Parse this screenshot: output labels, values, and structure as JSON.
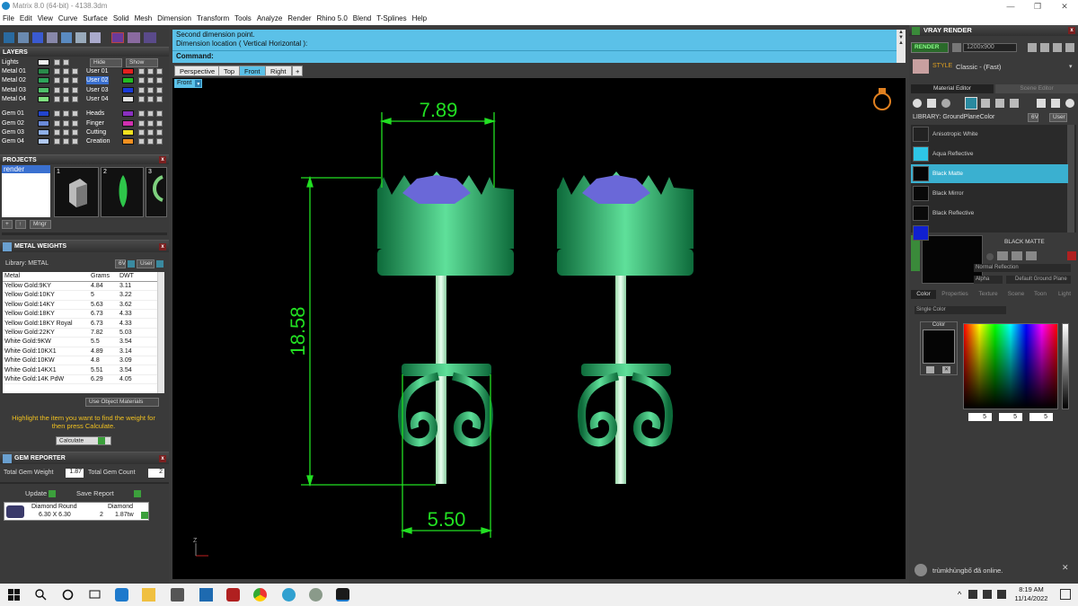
{
  "window": {
    "title": "Matrix 8.0 (64-bit) - 4138.3dm"
  },
  "menu": [
    "File",
    "Edit",
    "View",
    "Curve",
    "Surface",
    "Solid",
    "Mesh",
    "Dimension",
    "Transform",
    "Tools",
    "Analyze",
    "Render",
    "Rhino 5.0",
    "Blend",
    "T-Splines",
    "Help"
  ],
  "layers": {
    "title": "LAYERS",
    "lights": "Lights",
    "hide": "Hide",
    "show": "Show",
    "left": [
      {
        "name": "Metal 01",
        "color": "#2a8a4a"
      },
      {
        "name": "Metal 02",
        "color": "#2ea35a"
      },
      {
        "name": "Metal 03",
        "color": "#4fbf6a"
      },
      {
        "name": "Metal 04",
        "color": "#7fe07f"
      },
      {
        "name": "Gem 01",
        "color": "#2244cc"
      },
      {
        "name": "Gem 02",
        "color": "#6a8ad8"
      },
      {
        "name": "Gem 03",
        "color": "#8fb0e8"
      },
      {
        "name": "Gem 04",
        "color": "#b0c8f0"
      }
    ],
    "right": [
      {
        "name": "User 01",
        "color": "#e02020"
      },
      {
        "name": "User 02",
        "color": "#22bb22"
      },
      {
        "name": "User 03",
        "color": "#1a3ad8"
      },
      {
        "name": "User 04",
        "color": "#e0e0e0"
      },
      {
        "name": "Heads",
        "color": "#8a30c0"
      },
      {
        "name": "Finger",
        "color": "#d030b0"
      },
      {
        "name": "Cutting",
        "color": "#f0e020"
      },
      {
        "name": "Creation",
        "color": "#f09020"
      }
    ]
  },
  "projects": {
    "title": "PROJECTS",
    "item": "render",
    "thumbs": [
      "1",
      "2",
      "3"
    ],
    "mngr": "Mngr"
  },
  "metal_weights": {
    "title": "METAL WEIGHTS",
    "library": "Library: METAL",
    "lib_btn1": "6V",
    "lib_btn2": "User",
    "headers": [
      "Metal",
      "Grams",
      "DWT"
    ],
    "rows": [
      [
        "Yellow Gold:9KY",
        "4.84",
        "3.11"
      ],
      [
        "Yellow Gold:10KY",
        "5",
        "3.22"
      ],
      [
        "Yellow Gold:14KY",
        "5.63",
        "3.62"
      ],
      [
        "Yellow Gold:18KY",
        "6.73",
        "4.33"
      ],
      [
        "Yellow Gold:18KY Royal",
        "6.73",
        "4.33"
      ],
      [
        "Yellow Gold:22KY",
        "7.82",
        "5.03"
      ],
      [
        "White Gold:9KW",
        "5.5",
        "3.54"
      ],
      [
        "White Gold:10KX1",
        "4.89",
        "3.14"
      ],
      [
        "White Gold:10KW",
        "4.8",
        "3.09"
      ],
      [
        "White Gold:14KX1",
        "5.51",
        "3.54"
      ],
      [
        "White Gold:14K PdW",
        "6.29",
        "4.05"
      ]
    ],
    "use_object": "Use Object Materials",
    "hint": "Highlight the item you want to find the weight for then press Calculate.",
    "calculate": "Calculate"
  },
  "gem_reporter": {
    "title": "GEM REPORTER",
    "total_weight_label": "Total Gem Weight",
    "total_weight": "1.87",
    "total_count_label": "Total Gem Count",
    "total_count": "2",
    "update": "Update",
    "save": "Save Report",
    "gem": {
      "name": "Diamond Round",
      "size": "6.30 X 6.30",
      "type": "Diamond",
      "count": "2",
      "weight": "1.87tw"
    }
  },
  "command": {
    "line1": "Second dimension point.",
    "line2": "Dimension location ( Vertical  Horizontal ):",
    "prompt": "Command:"
  },
  "view_tabs": [
    "Perspective",
    "Top",
    "Front",
    "Right"
  ],
  "viewport_label": "Front",
  "dimensions": {
    "top": "7.89",
    "height": "18.58",
    "bottom": "5.50"
  },
  "vray": {
    "title": "VRAY RENDER",
    "render": "RENDER",
    "size": "1200x900",
    "style_label": "STYLE",
    "style": "Classic - (Fast)",
    "tabs": [
      "Material Editor",
      "Scene Editor"
    ],
    "library": "LIBRARY: GroundPlaneColor",
    "lib_btn1": "6V",
    "lib_btn2": "User",
    "materials": [
      {
        "name": "Anisotropic White",
        "color": "#222222"
      },
      {
        "name": "Aqua Reflective",
        "color": "#2ec6e6"
      },
      {
        "name": "Black Matte",
        "color": "#050505"
      },
      {
        "name": "Black Mirror",
        "color": "#080808"
      },
      {
        "name": "Black Reflective",
        "color": "#0a0a0a"
      },
      {
        "name": "",
        "color": "#1020d0"
      }
    ],
    "selected_name": "BLACK MATTE",
    "reflection": "Normal Reflection",
    "alpha": "Alpha",
    "ground": "Default Ground Plane",
    "subtabs": [
      "Color",
      "Properties",
      "Texture",
      "Scene",
      "Toon",
      "Light"
    ],
    "color_mode": "Single Color",
    "color_label": "Color",
    "rgb": [
      "5",
      "5",
      "5"
    ]
  },
  "notification": {
    "text": "trùmkhủngbố đã online."
  },
  "clock": {
    "time": "8:19 AM",
    "date": "11/14/2022"
  },
  "axis_label": "Z"
}
